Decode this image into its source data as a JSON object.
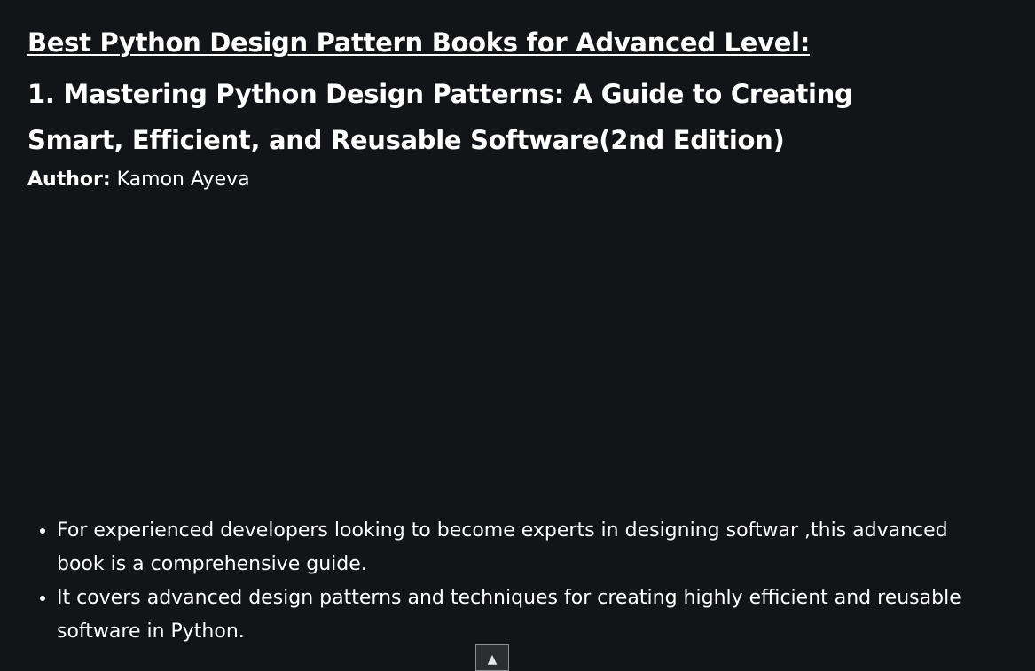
{
  "section": {
    "heading": "Best Python Design Pattern Books for Advanced Level:"
  },
  "book": {
    "title": "1. Mastering Python Design Patterns: A Guide to Creating Smart, Efficient, and Reusable Software(2nd Edition)",
    "author_label": "Author:",
    "author_name": "Kamon Ayeva",
    "bullets": [
      "For experienced developers looking to become experts in designing softwar ,this advanced book is a comprehensive guide.",
      "It covers advanced design patterns and techniques for creating highly efficient and reusable software in Python."
    ]
  },
  "scroll_top": {
    "icon": "chevron-up-icon",
    "glyph": "▲"
  },
  "colors": {
    "background": "#131417",
    "text": "#ffffff"
  }
}
